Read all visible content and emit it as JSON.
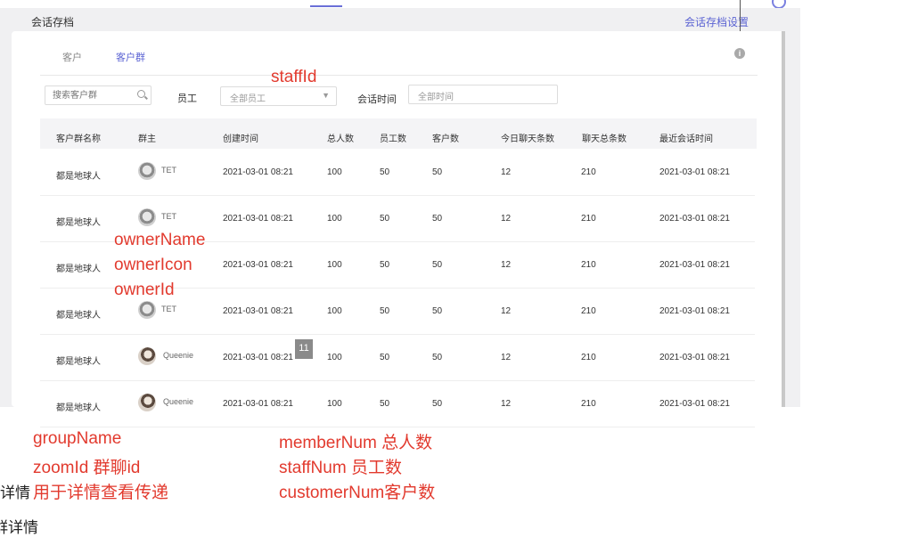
{
  "frame": {
    "title": "会话存档",
    "settings_link": "会话存档设置"
  },
  "tabs": [
    {
      "label": "客户"
    },
    {
      "label": "客户群"
    }
  ],
  "info_icon": "i",
  "filters": {
    "search_placeholder": "搜索客户群",
    "staff_label": "员工",
    "staff_value": "全部员工",
    "time_label": "会话时间",
    "time_placeholder": "全部时间"
  },
  "columns": [
    "客户群名称",
    "群主",
    "创建时间",
    "总人数",
    "员工数",
    "客户数",
    "今日聊天条数",
    "聊天总条数",
    "最近会话时间"
  ],
  "rows": [
    {
      "name": "都是地球人",
      "owner": "TET",
      "avatar": "avatar-gray",
      "created": "2021-03-01 08:21",
      "members": "100",
      "staff": "50",
      "customers": "50",
      "today": "12",
      "total": "210",
      "last": "2021-03-01 08:21"
    },
    {
      "name": "都是地球人",
      "owner": "TET",
      "avatar": "avatar-gray",
      "created": "2021-03-01 08:21",
      "members": "100",
      "staff": "50",
      "customers": "50",
      "today": "12",
      "total": "210",
      "last": "2021-03-01 08:21"
    },
    {
      "name": "都是地球人",
      "owner": "",
      "avatar": "avatar-hidden",
      "created": "2021-03-01 08:21",
      "members": "100",
      "staff": "50",
      "customers": "50",
      "today": "12",
      "total": "210",
      "last": "2021-03-01 08:21"
    },
    {
      "name": "都是地球人",
      "owner": "TET",
      "avatar": "avatar-gray",
      "created": "2021-03-01 08:21",
      "members": "100",
      "staff": "50",
      "customers": "50",
      "today": "12",
      "total": "210",
      "last": "2021-03-01 08:21"
    },
    {
      "name": "都是地球人",
      "owner": "Queenie",
      "avatar": "avatar-photo",
      "created": "2021-03-01 08:21",
      "members": "100",
      "staff": "50",
      "customers": "50",
      "today": "12",
      "total": "210",
      "last": "2021-03-01 08:21"
    },
    {
      "name": "都是地球人",
      "owner": "Queenie",
      "avatar": "avatar-photo",
      "created": "2021-03-01 08:21",
      "members": "100",
      "staff": "50",
      "customers": "50",
      "today": "12",
      "total": "210",
      "last": "2021-03-01 08:21"
    }
  ],
  "page_badge": "11",
  "annotations": {
    "staff_id": "staffId",
    "owner_name": "ownerName",
    "owner_icon": "ownerIcon",
    "owner_id": "ownerId",
    "group_name": "groupName",
    "zoom_id": "zoomId 群聊id",
    "detail_prefix": "详情",
    "detail_note": "用于详情查看传递",
    "member_num": "memberNum 总人数",
    "staff_num": "staffNum 员工数",
    "customer_num": "customerNum客户数",
    "cut_off_text": "群详情"
  },
  "colors": {
    "accent": "#5b63d3",
    "annotation": "#e23a2e"
  }
}
